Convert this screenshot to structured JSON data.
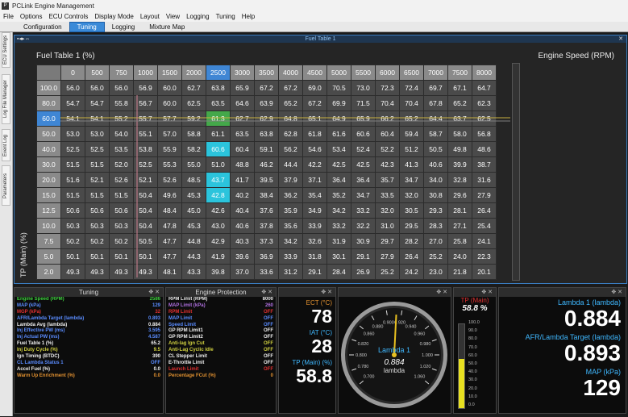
{
  "app": {
    "title": "PCLink Engine Management",
    "icon": "pclink-logo-icon"
  },
  "menu": [
    "File",
    "Options",
    "ECU Controls",
    "Display Mode",
    "Layout",
    "View",
    "Logging",
    "Tuning",
    "Help"
  ],
  "tabs": [
    "Configuration",
    "Tuning",
    "Logging",
    "Mixture Map"
  ],
  "active_tab": "Tuning",
  "sidebar_tabs": [
    "ECU Settings",
    "Log File Manager",
    "Event Log",
    "Parameters"
  ],
  "fuel_table": {
    "window_title": "Fuel Table 1",
    "table_title": "Fuel Table 1 (%)",
    "x_axis_title": "Engine Speed (RPM)",
    "y_axis_title": "TP (Main) (%)",
    "rpm": [
      "0",
      "500",
      "750",
      "1000",
      "1500",
      "2000",
      "2500",
      "3000",
      "3500",
      "4000",
      "4500",
      "5000",
      "5500",
      "6000",
      "6500",
      "7000",
      "7500",
      "8000"
    ],
    "tp": [
      "100.0",
      "80.0",
      "60.0",
      "50.0",
      "40.0",
      "30.0",
      "20.0",
      "15.0",
      "12.5",
      "10.0",
      "7.5",
      "5.0",
      "2.0"
    ],
    "rows": [
      [
        "56.0",
        "56.0",
        "56.0",
        "56.9",
        "60.0",
        "62.7",
        "63.8",
        "65.9",
        "67.2",
        "67.2",
        "69.0",
        "70.5",
        "73.0",
        "72.3",
        "72.4",
        "69.7",
        "67.1",
        "64.7"
      ],
      [
        "54.7",
        "54.7",
        "55.8",
        "56.7",
        "60.0",
        "62.5",
        "63.5",
        "64.6",
        "63.9",
        "65.2",
        "67.2",
        "69.9",
        "71.5",
        "70.4",
        "70.4",
        "67.8",
        "65.2",
        "62.3"
      ],
      [
        "54.1",
        "54.1",
        "55.2",
        "55.7",
        "57.7",
        "59.2",
        "61.3",
        "62.7",
        "62.9",
        "64.8",
        "65.1",
        "64.9",
        "65.9",
        "66.2",
        "65.2",
        "64.4",
        "63.7",
        "62.5"
      ],
      [
        "53.0",
        "53.0",
        "54.0",
        "55.1",
        "57.0",
        "58.8",
        "61.1",
        "63.5",
        "63.8",
        "62.8",
        "61.8",
        "61.6",
        "60.6",
        "60.4",
        "59.4",
        "58.7",
        "58.0",
        "56.8"
      ],
      [
        "52.5",
        "52.5",
        "53.5",
        "53.8",
        "55.9",
        "58.2",
        "60.6",
        "60.4",
        "59.1",
        "56.2",
        "54.6",
        "53.4",
        "52.4",
        "52.2",
        "51.2",
        "50.5",
        "49.8",
        "48.6"
      ],
      [
        "51.5",
        "51.5",
        "52.0",
        "52.5",
        "55.3",
        "55.0",
        "51.0",
        "48.8",
        "46.2",
        "44.4",
        "42.2",
        "42.5",
        "42.5",
        "42.3",
        "41.3",
        "40.6",
        "39.9",
        "38.7"
      ],
      [
        "51.6",
        "52.1",
        "52.6",
        "52.1",
        "52.6",
        "48.5",
        "43.7",
        "41.7",
        "39.5",
        "37.9",
        "37.1",
        "36.4",
        "36.4",
        "35.7",
        "34.7",
        "34.0",
        "32.8",
        "31.6"
      ],
      [
        "51.5",
        "51.5",
        "51.5",
        "50.4",
        "49.6",
        "45.3",
        "42.8",
        "40.2",
        "38.4",
        "36.2",
        "35.4",
        "35.2",
        "34.7",
        "33.5",
        "32.0",
        "30.8",
        "29.6",
        "27.9"
      ],
      [
        "50.6",
        "50.6",
        "50.6",
        "50.4",
        "48.4",
        "45.0",
        "42.6",
        "40.4",
        "37.6",
        "35.9",
        "34.9",
        "34.2",
        "33.2",
        "32.0",
        "30.5",
        "29.3",
        "28.1",
        "26.4"
      ],
      [
        "50.3",
        "50.3",
        "50.3",
        "50.4",
        "47.8",
        "45.3",
        "43.0",
        "40.6",
        "37.8",
        "35.6",
        "33.9",
        "33.2",
        "32.2",
        "31.0",
        "29.5",
        "28.3",
        "27.1",
        "25.4"
      ],
      [
        "50.2",
        "50.2",
        "50.2",
        "50.5",
        "47.7",
        "44.8",
        "42.9",
        "40.3",
        "37.3",
        "34.2",
        "32.6",
        "31.9",
        "30.9",
        "29.7",
        "28.2",
        "27.0",
        "25.8",
        "24.1"
      ],
      [
        "50.1",
        "50.1",
        "50.1",
        "50.1",
        "47.7",
        "44.3",
        "41.9",
        "39.6",
        "36.9",
        "33.9",
        "31.8",
        "30.1",
        "29.1",
        "27.9",
        "26.4",
        "25.2",
        "24.0",
        "22.3"
      ],
      [
        "49.3",
        "49.3",
        "49.3",
        "49.3",
        "48.1",
        "43.3",
        "39.8",
        "37.0",
        "33.6",
        "31.2",
        "29.1",
        "28.4",
        "26.9",
        "25.2",
        "24.2",
        "23.0",
        "21.8",
        "20.1"
      ]
    ],
    "highlight": {
      "rpm_col": 6,
      "tp_row": 2,
      "green": [
        [
          2,
          6
        ]
      ],
      "cyan": [
        [
          4,
          6
        ],
        [
          6,
          6
        ],
        [
          7,
          6
        ]
      ]
    }
  },
  "tuning_panel": {
    "title": "Tuning",
    "rows": [
      {
        "label": "Engine Speed (RPM)",
        "value": "2586",
        "color": "#3fd23f"
      },
      {
        "label": "MAP (kPa)",
        "value": "129",
        "color": "#5a8cff"
      },
      {
        "label": "MGP (kPa)",
        "value": "32",
        "color": "#e03030"
      },
      {
        "label": "AFR/Lambda Target (lambda)",
        "value": "0.893",
        "color": "#5a8cff"
      },
      {
        "label": "Lambda Avg (lambda)",
        "value": "0.884",
        "color": "#eeeeee"
      },
      {
        "label": "Inj Effective PW (ms)",
        "value": "3.595",
        "color": "#5a8cff"
      },
      {
        "label": "Inj Actual PW (ms)",
        "value": "4.587",
        "color": "#5a8cff"
      },
      {
        "label": "Fuel Table 1 (%)",
        "value": "65.2",
        "color": "#eeeeee"
      },
      {
        "label": "Inj Duty Cycle (%)",
        "value": "9.5",
        "color": "#d0d040"
      },
      {
        "label": "Ign Timing (BTDC)",
        "value": "390",
        "color": "#eeeeee"
      },
      {
        "label": "CL Lambda Status 1",
        "value": "OFF",
        "color": "#5a8cff"
      },
      {
        "label": "Accel Fuel (%)",
        "value": "0.0",
        "color": "#eeeeee"
      },
      {
        "label": "Warm Up Enrichment (%)",
        "value": "0.0",
        "color": "#e09030"
      }
    ]
  },
  "protection_panel": {
    "title": "Engine Protection",
    "rows": [
      {
        "label": "RPM Limit (RPM)",
        "value": "8000",
        "color": "#eeeeee"
      },
      {
        "label": "MAP Limit (kPa)",
        "value": "260",
        "color": "#b070e0"
      },
      {
        "label": "RPM Limit",
        "value": "OFF",
        "color": "#e03030"
      },
      {
        "label": "MAP Limit",
        "value": "OFF",
        "color": "#5a8cff"
      },
      {
        "label": "Speed Limit",
        "value": "OFF",
        "color": "#5a8cff"
      },
      {
        "label": "GP RPM Limit1",
        "value": "OFF",
        "color": "#eeeeee"
      },
      {
        "label": "GP RPM Limit2",
        "value": "OFF",
        "color": "#eeeeee"
      },
      {
        "label": "Anti-lag Ign Cut",
        "value": "OFF",
        "color": "#d0d040"
      },
      {
        "label": "Anti-Lag Cyclic Idle",
        "value": "OFF",
        "color": "#d0d040"
      },
      {
        "label": "CL Stepper Limit",
        "value": "OFF",
        "color": "#eeeeee"
      },
      {
        "label": "E-Throttle Limit",
        "value": "OFF",
        "color": "#eeeeee"
      },
      {
        "label": "Launch Limit",
        "value": "OFF",
        "color": "#e03030"
      },
      {
        "label": "Percentage FCut (%)",
        "value": "0",
        "color": "#e09030"
      }
    ]
  },
  "mini_gauges": [
    {
      "label": "ECT (°C)",
      "value": "78",
      "color": "#e09030"
    },
    {
      "label": "IAT (°C)",
      "value": "28",
      "color": "#3fb8ff"
    },
    {
      "label": "TP (Main) (%)",
      "value": "58.8",
      "color": "#3fb8ff"
    }
  ],
  "dial": {
    "label": "Lambda 1",
    "value": "0.884",
    "unit": "lambda",
    "ticks": [
      "0.700",
      "0.780",
      "0.800",
      "0.820",
      "0.860",
      "0.880",
      "0.900",
      "0.920",
      "0.940",
      "0.960",
      "0.980",
      "1.000",
      "1.020",
      "1.060"
    ],
    "min": 0.7,
    "max": 1.06,
    "current": 0.884
  },
  "tp_bar": {
    "label": "TP (Main)",
    "value": "58.8 %",
    "ticks": [
      "100.0",
      "90.0",
      "80.0",
      "70.0",
      "60.0",
      "50.0",
      "40.0",
      "30.0",
      "20.0",
      "10.0",
      "0.0"
    ],
    "level": 0.588
  },
  "right_readouts": [
    {
      "label": "Lambda 1 (lambda)",
      "value": "0.884"
    },
    {
      "label": "AFR/Lambda Target (lambda)",
      "value": "0.893"
    },
    {
      "label": "MAP (kPa)",
      "value": "129"
    }
  ],
  "colors": {
    "accent": "#3f86d4",
    "highlight_green": "#44a84a",
    "highlight_cyan": "#2bc4dc"
  }
}
